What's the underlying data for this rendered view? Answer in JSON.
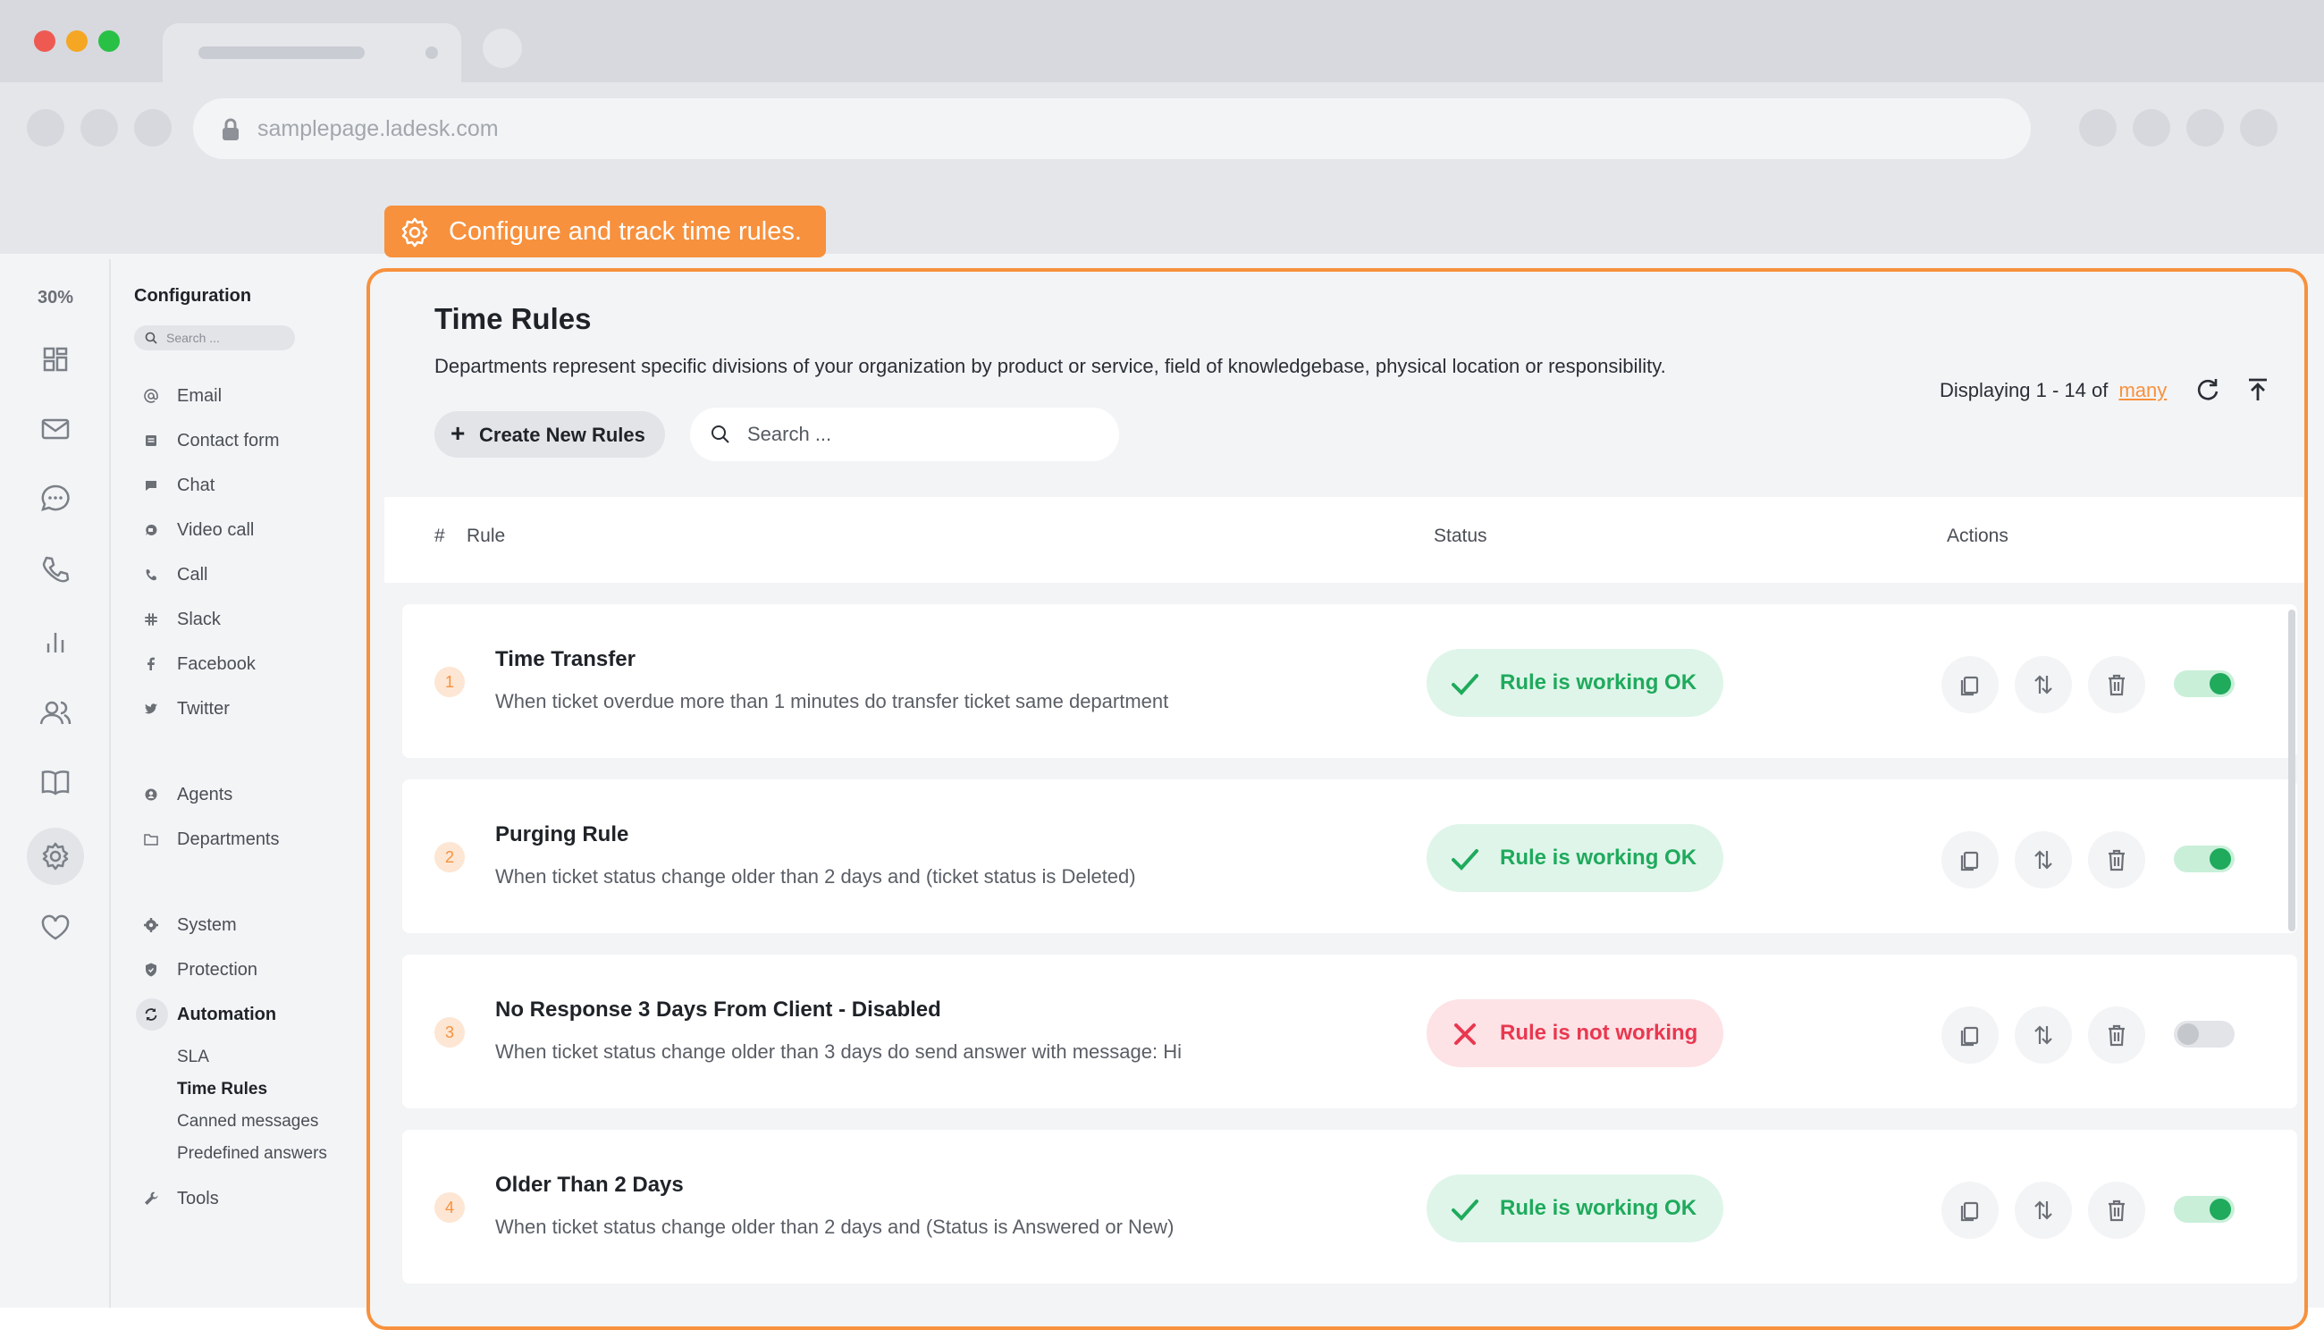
{
  "browser": {
    "url": "samplepage.ladesk.com",
    "traffic_lights": [
      "#ee5a52",
      "#f5a623",
      "#29c046"
    ]
  },
  "callout": {
    "text": "Configure and track time rules."
  },
  "icon_rail": {
    "zoom": "30%",
    "icons": [
      "dashboard-icon",
      "mail-icon",
      "chat-bubble-icon",
      "phone-icon",
      "bar-chart-icon",
      "users-icon",
      "book-icon",
      "settings-icon",
      "heart-icon"
    ],
    "active": "settings-icon"
  },
  "menu": {
    "title": "Configuration",
    "search_placeholder": "Search ...",
    "items": [
      {
        "label": "Email",
        "icon": "at-icon"
      },
      {
        "label": "Contact form",
        "icon": "form-icon"
      },
      {
        "label": "Chat",
        "icon": "chat-icon"
      },
      {
        "label": "Video call",
        "icon": "video-icon"
      },
      {
        "label": "Call",
        "icon": "phone-icon"
      },
      {
        "label": "Slack",
        "icon": "slack-icon"
      },
      {
        "label": "Facebook",
        "icon": "facebook-icon"
      },
      {
        "label": "Twitter",
        "icon": "twitter-icon"
      }
    ],
    "items2": [
      {
        "label": "Agents",
        "icon": "agents-icon"
      },
      {
        "label": "Departments",
        "icon": "folder-icon"
      }
    ],
    "items3": [
      {
        "label": "System",
        "icon": "gear-icon"
      },
      {
        "label": "Protection",
        "icon": "shield-icon"
      },
      {
        "label": "Automation",
        "icon": "automation-icon"
      }
    ],
    "subitems": [
      "SLA",
      "Time Rules",
      "Canned messages",
      "Predefined answers"
    ],
    "active_subitem": "Time Rules",
    "tools": {
      "label": "Tools",
      "icon": "wrench-icon"
    }
  },
  "panel": {
    "title": "Time Rules",
    "description": "Departments represent specific divisions of your organization by product or service, field of knowledgebase, physical location or responsibility.",
    "create_button": "Create New Rules",
    "search_placeholder": "Search ...",
    "display_prefix": "Displaying 1 - 14 of",
    "display_link": "many",
    "columns": {
      "hash": "#",
      "rule": "Rule",
      "status": "Status",
      "actions": "Actions"
    }
  },
  "rules": [
    {
      "num": "1",
      "name": "Time Transfer",
      "desc": "When ticket overdue more than 1 minutes do transfer ticket same department",
      "status": "Rule is working OK",
      "ok": true,
      "enabled": true
    },
    {
      "num": "2",
      "name": "Purging Rule",
      "desc": "When ticket status change older than 2 days and (ticket status is Deleted)",
      "status": "Rule is working OK",
      "ok": true,
      "enabled": true
    },
    {
      "num": "3",
      "name": "No Response 3 Days From Client - Disabled",
      "desc": "When ticket status change older than 3 days do send answer with message: Hi",
      "status": "Rule is not working",
      "ok": false,
      "enabled": false
    },
    {
      "num": "4",
      "name": "Older Than 2 Days",
      "desc": "When ticket status change older than 2 days and (Status is Answered or New)",
      "status": "Rule is working OK",
      "ok": true,
      "enabled": true
    }
  ],
  "colors": {
    "accent": "#f7913d",
    "ok": "#1faa5c",
    "error": "#e8384f"
  }
}
